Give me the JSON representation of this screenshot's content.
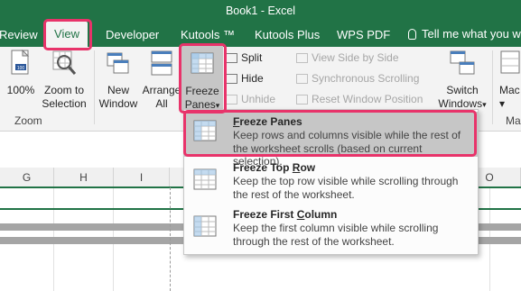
{
  "window": {
    "title": "Book1 - Excel"
  },
  "tabs": [
    {
      "label": "Review"
    },
    {
      "label": "View"
    },
    {
      "label": "Developer"
    },
    {
      "label": "Kutools ™"
    },
    {
      "label": "Kutools Plus"
    },
    {
      "label": "WPS PDF"
    }
  ],
  "tellme": {
    "label": "Tell me what you wa"
  },
  "ribbon": {
    "zoom100": {
      "label": "100%"
    },
    "zoom_to_selection": {
      "line1": "Zoom to",
      "line2": "Selection"
    },
    "zoom_group": "Zoom",
    "new_window": {
      "line1": "New",
      "line2": "Window"
    },
    "arrange_all": {
      "line1": "Arrange",
      "line2": "All"
    },
    "freeze_panes": {
      "line1": "Freeze",
      "line2": "Panes",
      "caret": "▾"
    },
    "split": "Split",
    "hide": "Hide",
    "unhide": "Unhide",
    "view_side_by_side": "View Side by Side",
    "synchronous_scrolling": "Synchronous Scrolling",
    "reset_window_position": "Reset Window Position",
    "switch_windows": {
      "line1": "Switch",
      "line2": "Windows",
      "caret": "▾"
    },
    "macros": {
      "line1": "Mac",
      "line2": "▾"
    },
    "macros_group": "Mac"
  },
  "columns": [
    "G",
    "H",
    "I",
    "O"
  ],
  "dropdown": {
    "items": [
      {
        "title_prefix": "",
        "title_accel": "F",
        "title_rest": "reeze Panes",
        "desc": "Keep rows and columns visible while the rest of the worksheet scrolls (based on current selection)."
      },
      {
        "title_prefix": "Freeze Top ",
        "title_accel": "R",
        "title_rest": "ow",
        "desc": "Keep the top row visible while scrolling through the rest of the worksheet."
      },
      {
        "title_prefix": "Freeze First ",
        "title_accel": "C",
        "title_rest": "olumn",
        "desc": "Keep the first column visible while scrolling through the rest of the worksheet."
      }
    ]
  },
  "colors": {
    "excel_green": "#217346",
    "highlight_red": "#e8336a",
    "selected_gray": "#c6c6c6"
  }
}
